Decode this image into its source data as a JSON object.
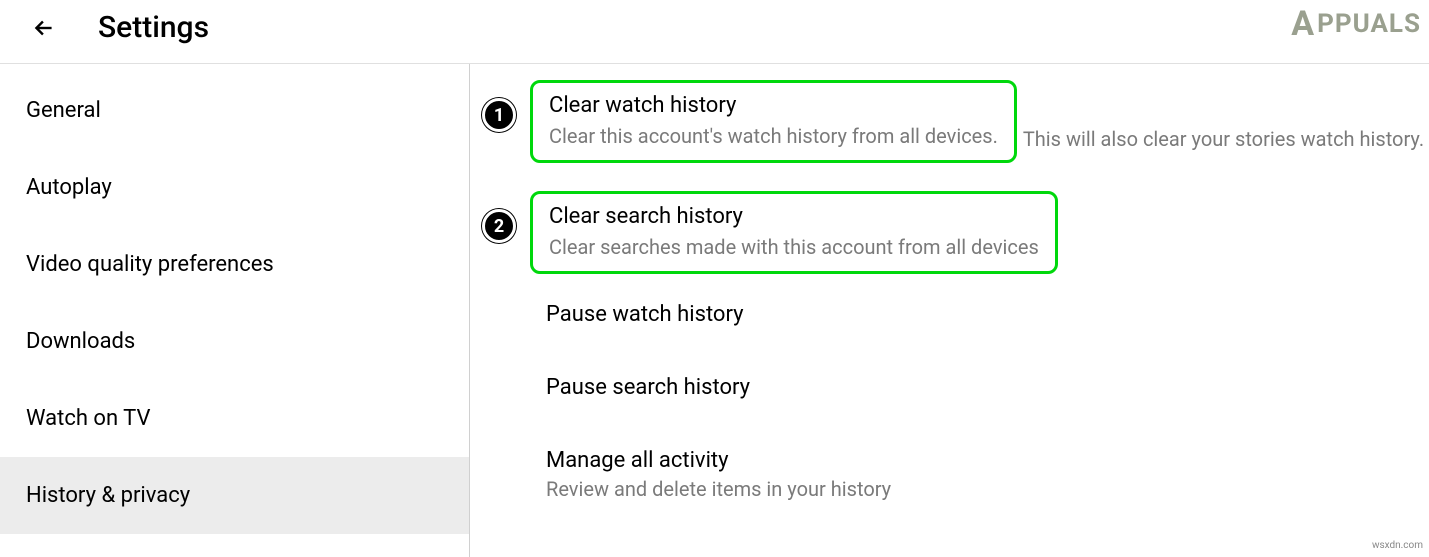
{
  "header": {
    "title": "Settings"
  },
  "sidebar": {
    "items": [
      {
        "label": "General"
      },
      {
        "label": "Autoplay"
      },
      {
        "label": "Video quality preferences"
      },
      {
        "label": "Downloads"
      },
      {
        "label": "Watch on TV"
      },
      {
        "label": "History & privacy"
      }
    ],
    "active_index": 5
  },
  "main": {
    "step1": {
      "badge": "1",
      "title": "Clear watch history",
      "sub_boxed": "Clear this account's watch history from all devices.",
      "sub_rest": "This will also clear your stories watch history."
    },
    "step2": {
      "badge": "2",
      "title": "Clear search history",
      "sub": "Clear searches made with this account from all devices"
    },
    "option3": {
      "title": "Pause watch history"
    },
    "option4": {
      "title": "Pause search history"
    },
    "option5": {
      "title": "Manage all activity",
      "sub": "Review and delete items in your history"
    }
  },
  "brand": {
    "logo_text": "PPUALS",
    "logo_prefix": "A"
  },
  "watermark": "wsxdn.com"
}
